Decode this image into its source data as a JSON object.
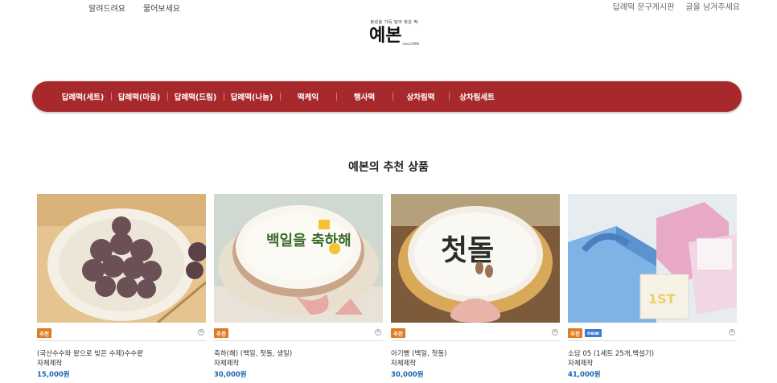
{
  "topbar": {
    "left": [
      "알려드려요",
      "물어보세요"
    ],
    "right": [
      "답례떡 문구게시판",
      "글을 남겨주세요"
    ]
  },
  "logo": {
    "tagline": "정성을 가득 담아 빚은 떡",
    "name": "예본",
    "since": "since1990"
  },
  "nav": {
    "items": [
      "답례떡(세트)",
      "답례떡(마음)",
      "답례떡(드림)",
      "답례떡(나눔)",
      "떡케익",
      "행사떡",
      "상차림떡",
      "상차림세트"
    ]
  },
  "section": {
    "title": "예본의 추천 상품"
  },
  "products": [
    {
      "name": "(국산수수와 팥으로 빚은 수제)수수팥",
      "maker": "자체제작",
      "price": "15,000원",
      "badges": [
        "추천"
      ]
    },
    {
      "name": "축하(해) (백일, 첫돌, 생일)",
      "maker": "자체제작",
      "price": "30,000원",
      "badges": [
        "추천"
      ],
      "cake_text": "백일을 축하해"
    },
    {
      "name": "아기빵 (백일, 첫돌)",
      "maker": "자체제작",
      "price": "30,000원",
      "badges": [
        "추천"
      ],
      "cake_text": "첫돌"
    },
    {
      "name": "소담 05 (1세트 25개,백설기)",
      "maker": "자체제작",
      "price": "41,000원",
      "badges": [
        "추천",
        "new"
      ]
    }
  ],
  "colors": {
    "nav_bg": "#a8292c",
    "price": "#1d63b0",
    "badge_recommend": "#e07a1f",
    "badge_new": "#3a7bd5"
  }
}
